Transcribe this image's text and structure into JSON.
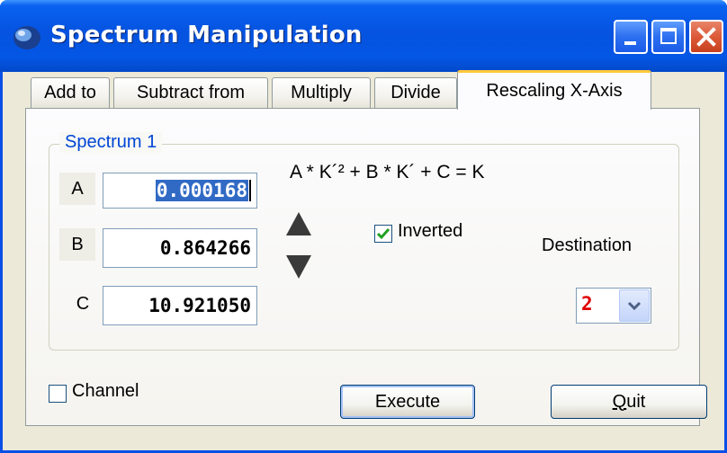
{
  "window": {
    "title": "Spectrum Manipulation",
    "title_color": "#ffffff",
    "titlebar_color": "#0553e0"
  },
  "tabs": [
    {
      "label": "Add to",
      "active": false
    },
    {
      "label": "Subtract from",
      "active": false
    },
    {
      "label": "Multiply",
      "active": false
    },
    {
      "label": "Divide",
      "active": false
    },
    {
      "label": "Rescaling X-Axis",
      "active": true
    }
  ],
  "group": {
    "title": "Spectrum 1",
    "title_color": "#0046d5"
  },
  "params": {
    "a": {
      "label": "A",
      "value": "0.000168",
      "selected": true
    },
    "b": {
      "label": "B",
      "value": "0.864266"
    },
    "c": {
      "label": "C",
      "value": "10.921050"
    }
  },
  "formula": "A * K´² + B * K´ + C = K",
  "stepper": {
    "up_icon": "triangle-up-icon",
    "down_icon": "triangle-down-icon"
  },
  "inverted": {
    "label": "Inverted",
    "checked": true
  },
  "destination": {
    "label": "Destination",
    "selected": "2",
    "value_color": "#e00000"
  },
  "channel": {
    "label": "Channel",
    "checked": false
  },
  "buttons": {
    "execute": "Execute",
    "quit": "Quit",
    "quit_mnemonic": "Q"
  }
}
